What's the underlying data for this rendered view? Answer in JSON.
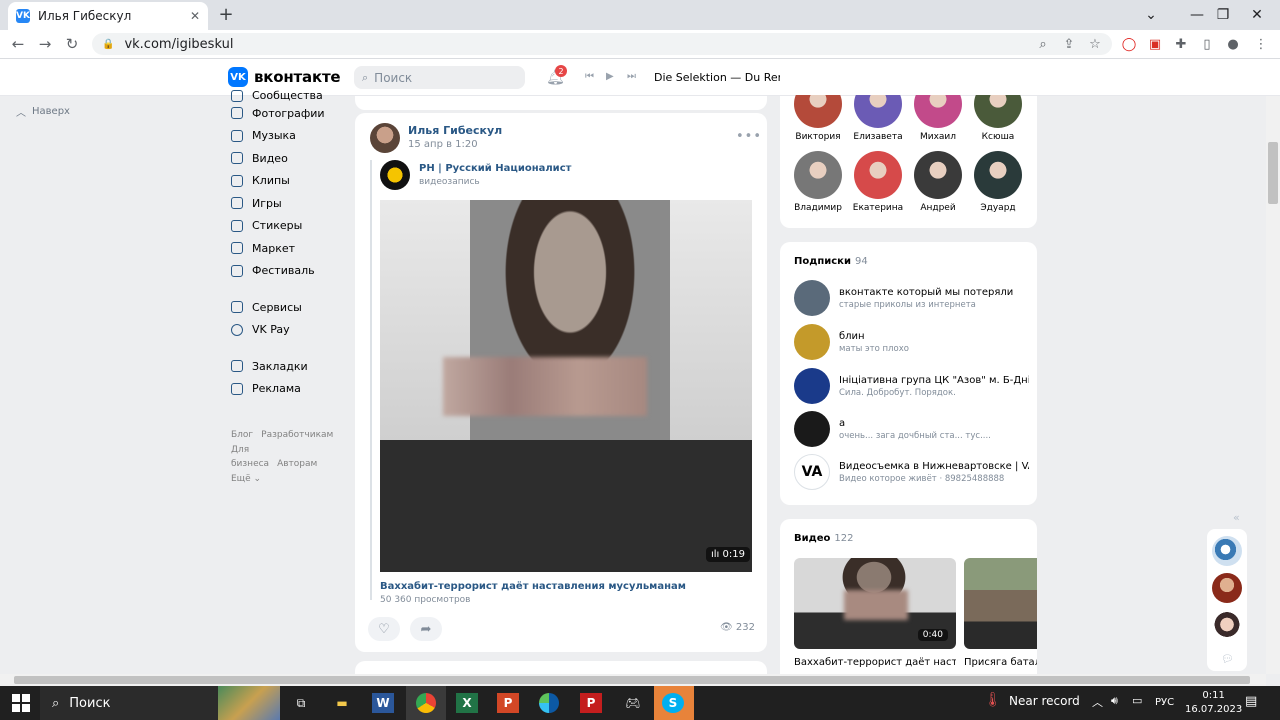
{
  "browser": {
    "tab_title": "Илья Гибескул",
    "new_tab": "+",
    "url": "vk.com/igibeskul",
    "nav": {
      "back": "←",
      "forward": "→",
      "reload": "↻"
    },
    "window": {
      "minimize": "⌄",
      "maximize": "—",
      "restore": "❐",
      "close": "✕"
    }
  },
  "vk": {
    "logo_text": "вконтакте",
    "search_placeholder": "Поиск",
    "notifications_count": "2",
    "now_playing": "Die Selektion — Du Rennst"
  },
  "left_nav": {
    "scroll_up": "Наверх",
    "items_top": [
      "Сообщества",
      "Фотографии",
      "Музыка",
      "Видео",
      "Клипы",
      "Игры",
      "Стикеры",
      "Маркет",
      "Фестиваль"
    ],
    "items_mid": [
      "Сервисы",
      "VK Pay"
    ],
    "items_bottom": [
      "Закладки",
      "Реклама"
    ],
    "footer": {
      "blog": "Блог",
      "devs": "Разработчикам",
      "business": "Для бизнеса",
      "authors": "Авторам",
      "more": "Ещё ⌄"
    }
  },
  "post": {
    "author": "Илья Гибескул",
    "date": "15 апр в 1:20",
    "more": "•••",
    "repost_source": "РН | Русский Националист",
    "repost_type": "видеозапись",
    "video_duration": "ılı 0:19",
    "video_title": "Ваххабит-террорист даёт наставления мусульманам",
    "video_views": "50 360 просмотров",
    "views": "232"
  },
  "friends": [
    {
      "name": "Виктория",
      "color": "#b44a3a"
    },
    {
      "name": "Елизавета",
      "color": "#6b5bb5"
    },
    {
      "name": "Михаил",
      "color": "#c24a8a"
    },
    {
      "name": "Ксюша",
      "color": "#4a5a3a"
    },
    {
      "name": "Владимир",
      "color": "#777777"
    },
    {
      "name": "Екатерина",
      "color": "#d64a4a"
    },
    {
      "name": "Андрей",
      "color": "#3a3a3a"
    },
    {
      "name": "Эдуард",
      "color": "#2a3a3a"
    }
  ],
  "subscriptions": {
    "title": "Подписки",
    "count": "94",
    "items": [
      {
        "name": "вконтакте который мы потеряли",
        "desc": "старые приколы из интернета",
        "color": "#5a6a7a"
      },
      {
        "name": "блин",
        "desc": "маты это плохо",
        "color": "#c49a2a"
      },
      {
        "name": "Ініціативна група ЦК \"Азов\" м. Б-Дніст...",
        "desc": "Сила. Добробут. Порядок.",
        "color": "#1a3a8a"
      },
      {
        "name": "а",
        "desc": "очень... зага дочбный ста... тус....",
        "color": "#1a1a1a"
      },
      {
        "name": "Видеосъемка в Нижневартовске | VAR...",
        "desc": "Видео которое живёт · 89825488888",
        "color": "#ffffff"
      }
    ]
  },
  "videos": {
    "title": "Видео",
    "count": "122",
    "items": [
      {
        "caption": "Ваххабит-террорист даёт наста...",
        "duration": "0:40"
      },
      {
        "caption": "Присяга батал"
      }
    ]
  },
  "chat_collapse": "«",
  "taskbar": {
    "search": "Поиск",
    "weather": "Near record",
    "lang": "РУС",
    "time": "0:11",
    "date": "16.07.2023"
  }
}
